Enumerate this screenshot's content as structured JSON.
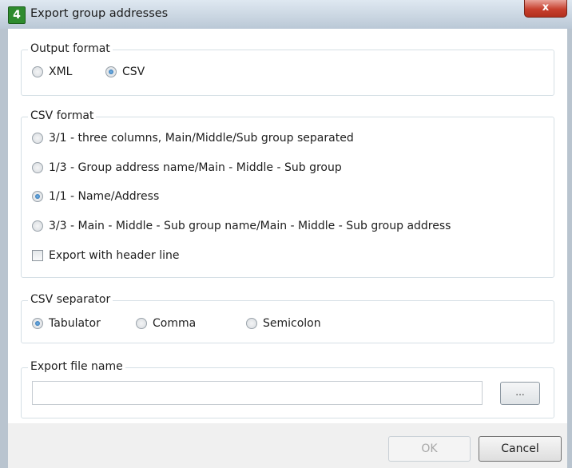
{
  "window": {
    "title": "Export group addresses",
    "app_icon_glyph": "4",
    "close_glyph": "x"
  },
  "output_format": {
    "legend": "Output format",
    "options": [
      {
        "label": "XML",
        "checked": false
      },
      {
        "label": "CSV",
        "checked": true
      }
    ]
  },
  "csv_format": {
    "legend": "CSV format",
    "options": [
      {
        "label": "3/1 - three columns, Main/Middle/Sub group separated",
        "checked": false
      },
      {
        "label": "1/3 - Group address name/Main - Middle - Sub group",
        "checked": false
      },
      {
        "label": "1/1 - Name/Address",
        "checked": true
      },
      {
        "label": "3/3 - Main - Middle - Sub group name/Main - Middle - Sub group address",
        "checked": false
      }
    ],
    "header_checkbox": {
      "label": "Export with header line",
      "checked": false
    }
  },
  "csv_separator": {
    "legend": "CSV separator",
    "options": [
      {
        "label": "Tabulator",
        "checked": true
      },
      {
        "label": "Comma",
        "checked": false
      },
      {
        "label": "Semicolon",
        "checked": false
      }
    ]
  },
  "export_file": {
    "legend": "Export file name",
    "value": "",
    "browse_label": "..."
  },
  "buttons": {
    "ok": "OK",
    "cancel": "Cancel"
  },
  "colors": {
    "title_gradient_top": "#dfe8f1",
    "close_red": "#c7402e",
    "radio_selected_blue": "#2167a8",
    "disabled_text": "#a7a7a7"
  }
}
